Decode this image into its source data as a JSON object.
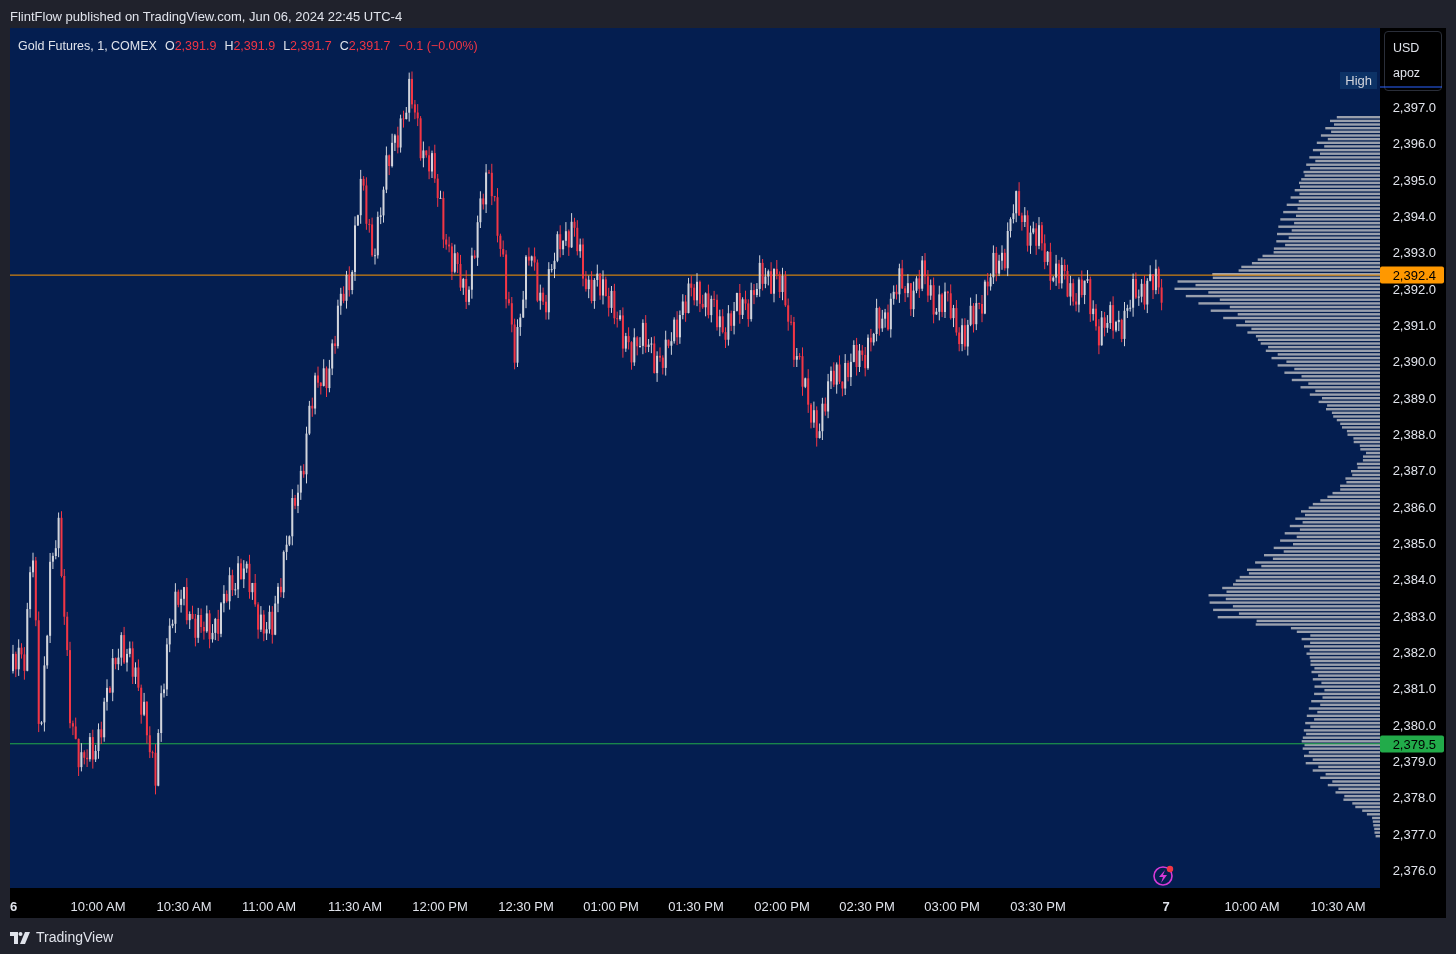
{
  "attribution": "FlintFlow published on TradingView.com, Jun 06, 2024 22:45 UTC-4",
  "legend": {
    "symbol": "Gold Futures, 1, COMEX",
    "fields": [
      {
        "key": "O",
        "value": "2,391.9"
      },
      {
        "key": "H",
        "value": "2,391.9"
      },
      {
        "key": "L",
        "value": "2,391.7"
      },
      {
        "key": "C",
        "value": "2,391.7"
      }
    ],
    "change": "−0.1 (−0.00%)"
  },
  "price_scale": {
    "currency": "USD",
    "unit": "apoz",
    "ticks": [
      "2,397.0",
      "2,396.0",
      "2,395.0",
      "2,394.0",
      "2,393.0",
      "2,392.0",
      "2,391.0",
      "2,390.0",
      "2,389.0",
      "2,388.0",
      "2,387.0",
      "2,386.0",
      "2,385.0",
      "2,384.0",
      "2,383.0",
      "2,382.0",
      "2,381.0",
      "2,380.0",
      "2,379.0",
      "2,378.0",
      "2,377.0",
      "2,376.0"
    ],
    "markers": [
      {
        "label": "2,392.4",
        "color": "#ff9800"
      },
      {
        "label": "2,379.5",
        "color": "#22ab4a"
      }
    ]
  },
  "profile": {
    "label": "High"
  },
  "time_axis": {
    "labels": [
      "6",
      "10:00 AM",
      "10:30 AM",
      "11:00 AM",
      "11:30 AM",
      "12:00 PM",
      "12:30 PM",
      "01:00 PM",
      "01:30 PM",
      "02:00 PM",
      "02:30 PM",
      "03:00 PM",
      "03:30 PM",
      "7",
      "10:00 AM",
      "10:30 AM"
    ]
  },
  "footer": {
    "brand": "TradingView"
  }
}
